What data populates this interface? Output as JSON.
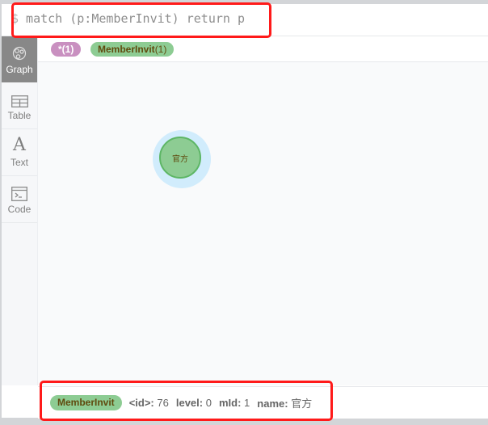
{
  "editor": {
    "prompt": "$",
    "query": " match (p:MemberInvit) return p"
  },
  "sidebar": {
    "items": [
      {
        "label": "Graph",
        "icon": "graph-icon",
        "active": true
      },
      {
        "label": "Table",
        "icon": "table-icon",
        "active": false
      },
      {
        "label": "Text",
        "icon": "text-icon",
        "glyph": "A",
        "active": false
      },
      {
        "label": "Code",
        "icon": "code-icon",
        "active": false
      }
    ]
  },
  "tags": {
    "all": {
      "label": "*",
      "count": "(1)"
    },
    "labels": [
      {
        "label": "MemberInvit",
        "count": "(1)",
        "color": "#8dcc93"
      }
    ]
  },
  "graph": {
    "nodes": [
      {
        "caption": "官方",
        "label": "MemberInvit",
        "color": "#8dcc93",
        "selected": true
      }
    ]
  },
  "details": {
    "label": "MemberInvit",
    "properties": [
      {
        "key": "<id>:",
        "value": "76"
      },
      {
        "key": "level:",
        "value": "0"
      },
      {
        "key": "mId:",
        "value": "1"
      },
      {
        "key": "name:",
        "value": "官方"
      }
    ]
  },
  "colors": {
    "highlight": "#ff1a1a",
    "active_tab": "#888888",
    "node_fill": "#8dcc93",
    "node_border": "#5db665",
    "halo": "#d1ecfc",
    "all_pill": "#c990c0"
  }
}
